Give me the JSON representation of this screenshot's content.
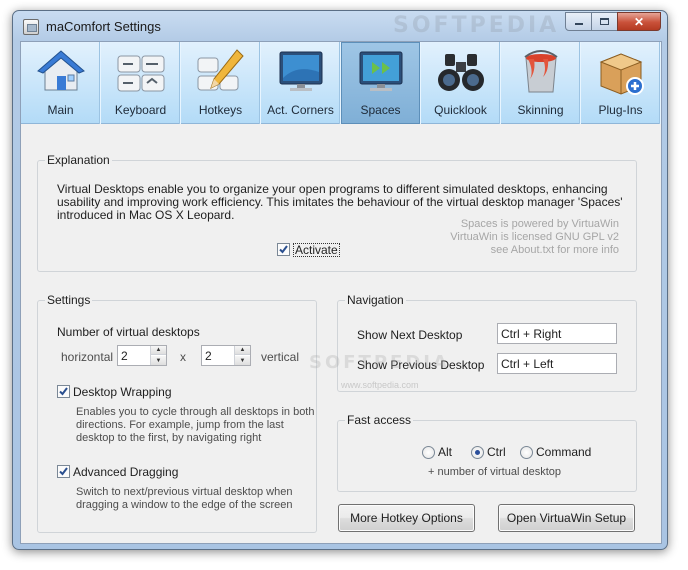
{
  "window": {
    "title": "maComfort Settings"
  },
  "tabs": [
    {
      "label": "Main",
      "icon": "house-icon"
    },
    {
      "label": "Keyboard",
      "icon": "keyboard-icon"
    },
    {
      "label": "Hotkeys",
      "icon": "keyboard-pencil-icon"
    },
    {
      "label": "Act. Corners",
      "icon": "monitor-corners-icon"
    },
    {
      "label": "Spaces",
      "icon": "spaces-desktop-icon",
      "active": true
    },
    {
      "label": "Quicklook",
      "icon": "binoculars-icon"
    },
    {
      "label": "Skinning",
      "icon": "paint-bucket-icon"
    },
    {
      "label": "Plug-Ins",
      "icon": "package-add-icon"
    }
  ],
  "explanation": {
    "title": "Explanation",
    "text": "Virtual Desktops enable you to organize your open programs to different simulated desktops, enhancing usability and improving work efficiency. This imitates the behaviour of the virtual desktop manager 'Spaces' introduced in Mac OS X Leopard.",
    "credits": [
      "Spaces is powered by VirtuaWin",
      "VirtuaWin is licensed GNU GPL v2",
      "see About.txt for more info"
    ],
    "activate_label": "Activate",
    "activate_checked": true
  },
  "settings": {
    "title": "Settings",
    "num_desktops_label": "Number of virtual desktops",
    "horizontal_label": "horizontal",
    "horizontal_value": "2",
    "times_label": "x",
    "vertical_value": "2",
    "vertical_label": "vertical",
    "wrapping": {
      "label": "Desktop Wrapping",
      "checked": true,
      "description": [
        "Enables you to cycle through all desktops in both",
        "directions. For example, jump from the last",
        "desktop to the first, by navigating right"
      ]
    },
    "dragging": {
      "label": "Advanced Dragging",
      "checked": true,
      "description": [
        "Switch to next/previous virtual desktop when",
        "dragging a window to the edge of the screen"
      ]
    }
  },
  "navigation": {
    "title": "Navigation",
    "next_label": "Show Next Desktop",
    "next_value": "Ctrl + Right",
    "prev_label": "Show Previous Desktop",
    "prev_value": "Ctrl + Left"
  },
  "fast_access": {
    "title": "Fast access",
    "options": [
      "Alt",
      "Ctrl",
      "Command"
    ],
    "selected": "Ctrl",
    "suffix": "+ number of virtual desktop"
  },
  "buttons": {
    "more_hotkeys": "More Hotkey Options",
    "virtuawin_setup": "Open VirtuaWin Setup"
  },
  "watermarks": {
    "top": "SOFTPEDIA",
    "middle": "SOFTPEDIA",
    "url": "www.softpedia.com"
  }
}
